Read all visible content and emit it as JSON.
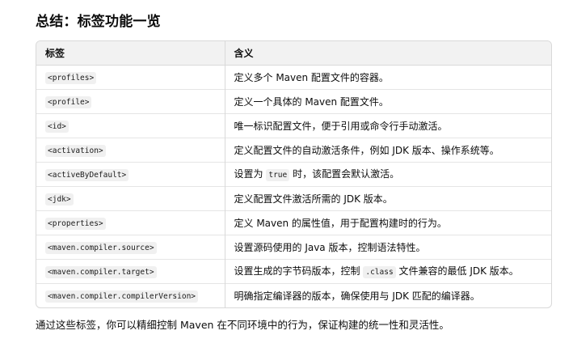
{
  "heading": "总结：标签功能一览",
  "table": {
    "headers": [
      "标签",
      "含义"
    ],
    "rows": [
      {
        "tag": "<profiles>",
        "desc": "定义多个 Maven 配置文件的容器。"
      },
      {
        "tag": "<profile>",
        "desc": "定义一个具体的 Maven 配置文件。"
      },
      {
        "tag": "<id>",
        "desc": "唯一标识配置文件，便于引用或命令行手动激活。"
      },
      {
        "tag": "<activation>",
        "desc": "定义配置文件的自动激活条件，例如 JDK 版本、操作系统等。"
      },
      {
        "tag": "<activeByDefault>",
        "desc_before": "设置为",
        "desc_code": "true",
        "desc_after": "时，该配置会默认激活。"
      },
      {
        "tag": "<jdk>",
        "desc": "定义配置文件激活所需的 JDK 版本。"
      },
      {
        "tag": "<properties>",
        "desc": "定义 Maven 的属性值，用于配置构建时的行为。"
      },
      {
        "tag": "<maven.compiler.source>",
        "desc": "设置源码使用的 Java 版本，控制语法特性。"
      },
      {
        "tag": "<maven.compiler.target>",
        "desc_before": "设置生成的字节码版本，控制",
        "desc_code": ".class",
        "desc_after": "文件兼容的最低 JDK 版本。"
      },
      {
        "tag": "<maven.compiler.compilerVersion>",
        "desc": "明确指定编译器的版本，确保使用与 JDK 匹配的编译器。"
      }
    ]
  },
  "summary": "通过这些标签，你可以精细控制 Maven 在不同环境中的行为，保证构建的统一性和灵活性。",
  "colors": {
    "header_bg": "#f2f2f2",
    "border": "#d9d9d9",
    "code_bg": "#f0f0f0"
  }
}
